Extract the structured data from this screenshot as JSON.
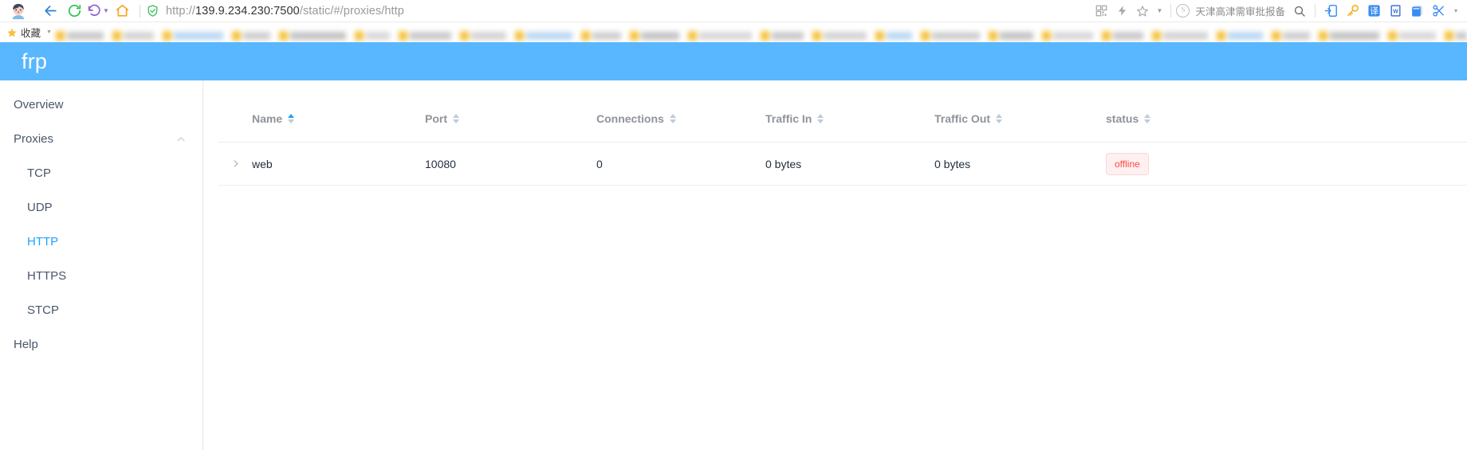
{
  "browser": {
    "nav": {
      "back_label": "Back",
      "reload_label": "Reload",
      "history_label": "History",
      "home_label": "Home"
    },
    "address": {
      "security_icon": "shield-check-icon",
      "url_scheme": "http://",
      "url_host": "139.9.234.230:7500",
      "url_path": "/static/#/proxies/http",
      "full_url": "http://139.9.234.230:7500/static/#/proxies/http"
    },
    "toolbar_icons": [
      {
        "name": "qrcode-icon",
        "glyph": "qr"
      },
      {
        "name": "lightning-icon",
        "glyph": "bolt"
      },
      {
        "name": "star-bookmark-icon",
        "glyph": "star"
      },
      {
        "name": "chevron-down-icon",
        "glyph": "caret"
      }
    ],
    "search_engine": {
      "badge": "S",
      "text": "天津高津需审批报备"
    },
    "extensions": [
      {
        "name": "search-icon",
        "glyph": "magnifier"
      },
      {
        "name": "screen-cast-icon",
        "glyph": "cast"
      },
      {
        "name": "password-key-icon",
        "glyph": "key"
      },
      {
        "name": "translate-icon",
        "glyph": "译"
      },
      {
        "name": "word-document-icon",
        "glyph": "W"
      },
      {
        "name": "notes-icon",
        "glyph": "notes"
      },
      {
        "name": "scissors-capture-icon",
        "glyph": "scissors"
      },
      {
        "name": "overflow-caret-icon",
        "glyph": "caret"
      }
    ],
    "bookmarks": {
      "favorites_label": "收藏",
      "blurred_items_count": 26
    }
  },
  "app": {
    "title": "frp",
    "accent_color": "#58b7ff",
    "sidebar": {
      "overview": {
        "label": "Overview"
      },
      "proxies": {
        "label": "Proxies",
        "expanded": true,
        "chevron_icon": "chevron-up-icon",
        "children": [
          {
            "label": "TCP",
            "active": false
          },
          {
            "label": "UDP",
            "active": false
          },
          {
            "label": "HTTP",
            "active": true
          },
          {
            "label": "HTTPS",
            "active": false
          },
          {
            "label": "STCP",
            "active": false
          }
        ]
      },
      "help": {
        "label": "Help"
      }
    },
    "table": {
      "columns": [
        {
          "key": "name",
          "label": "Name",
          "sortable": true,
          "sort": "asc"
        },
        {
          "key": "port",
          "label": "Port",
          "sortable": true,
          "sort": "none"
        },
        {
          "key": "connections",
          "label": "Connections",
          "sortable": true,
          "sort": "none"
        },
        {
          "key": "traffic_in",
          "label": "Traffic In",
          "sortable": true,
          "sort": "none"
        },
        {
          "key": "traffic_out",
          "label": "Traffic Out",
          "sortable": true,
          "sort": "none"
        },
        {
          "key": "status",
          "label": "status",
          "sortable": true,
          "sort": "none"
        }
      ],
      "rows": [
        {
          "expand_icon": "chevron-right-icon",
          "name": "web",
          "port": "10080",
          "connections": "0",
          "traffic_in": "0 bytes",
          "traffic_out": "0 bytes",
          "status": "offline",
          "status_color": "#ff4949"
        }
      ]
    }
  }
}
